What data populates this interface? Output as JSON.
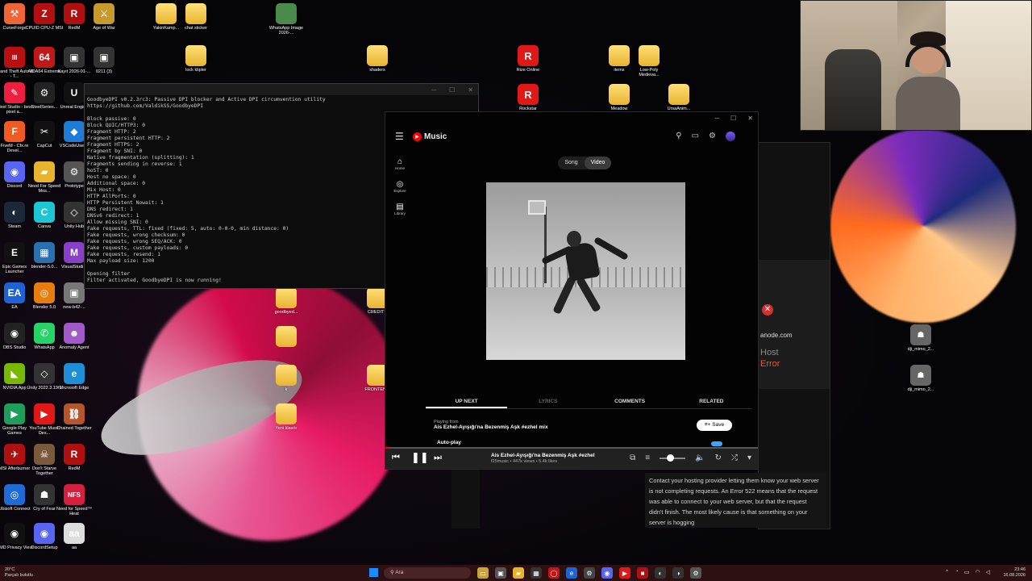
{
  "desktop": {
    "icons_left": [
      {
        "label": "CurseForge",
        "color": "#f16436",
        "glyph": "⚒"
      },
      {
        "label": "CPUID CPU-Z MSI",
        "color": "#b01010",
        "glyph": "Z"
      },
      {
        "label": "RedM",
        "color": "#b01010",
        "glyph": "R"
      },
      {
        "label": "Age of War",
        "color": "#c79a2e",
        "glyph": "⚔"
      },
      {
        "label": "Grand Theft Auto III - T...",
        "color": "#b81010",
        "glyph": "III"
      },
      {
        "label": "AIDA64 Extreme",
        "color": "#c01818",
        "glyph": "64"
      },
      {
        "label": "Kayıt 2026-01-...",
        "color": "#333",
        "glyph": "▣"
      },
      {
        "label": "0211 (3)",
        "color": "#333",
        "glyph": "▣"
      },
      {
        "label": "Pixel Studio - best pixel a...",
        "color": "#ee1e3e",
        "glyph": "✎"
      },
      {
        "label": "SteelSeries...",
        "color": "#222",
        "glyph": "⚙"
      },
      {
        "label": "Unreal Engine",
        "color": "#111",
        "glyph": "U"
      },
      {
        "label": "FiveM - Cfx.re Devel...",
        "color": "#f05a23",
        "glyph": "F"
      },
      {
        "label": "CapCut",
        "color": "#111",
        "glyph": "✂"
      },
      {
        "label": "VSCodeUser...",
        "color": "#1e7bd6",
        "glyph": "◆"
      },
      {
        "label": "Discord",
        "color": "#5865f2",
        "glyph": "◉"
      },
      {
        "label": "Need For Speed Mos...",
        "color": "#e8b42e",
        "glyph": "▰"
      },
      {
        "label": "Prototype",
        "color": "#555",
        "glyph": "⚙"
      },
      {
        "label": "Steam",
        "color": "#1b2838",
        "glyph": "◐"
      },
      {
        "label": "Canva",
        "color": "#1cc6d3",
        "glyph": "C"
      },
      {
        "label": "Unity Hub",
        "color": "#333",
        "glyph": "◇"
      },
      {
        "label": "Epic Games Launcher",
        "color": "#111",
        "glyph": "E"
      },
      {
        "label": "blender-5.0...",
        "color": "#2a6fb0",
        "glyph": "▦"
      },
      {
        "label": "VisualStudi...",
        "color": "#8a3fc9",
        "glyph": "M"
      },
      {
        "label": "EA",
        "color": "#1e63d6",
        "glyph": "EA"
      },
      {
        "label": "Blender 5.0",
        "color": "#e87d0d",
        "glyph": "◎"
      },
      {
        "label": "new-b42-...",
        "color": "#777",
        "glyph": "▣"
      },
      {
        "label": "OBS Studio",
        "color": "#222",
        "glyph": "◉"
      },
      {
        "label": "WhatsApp",
        "color": "#25d366",
        "glyph": "✆"
      },
      {
        "label": "Anomaly Agent",
        "color": "#a35ac9",
        "glyph": "☻"
      },
      {
        "label": "NVIDIA App",
        "color": "#76b900",
        "glyph": "◣"
      },
      {
        "label": "Unity 2022.3.19f1",
        "color": "#333",
        "glyph": "◇"
      },
      {
        "label": "Microsoft Edge",
        "color": "#1e8fd6",
        "glyph": "e"
      },
      {
        "label": "Google Play Games",
        "color": "#1e9e5a",
        "glyph": "▶"
      },
      {
        "label": "YouTube Music Des...",
        "color": "#e01818",
        "glyph": "▶"
      },
      {
        "label": "Chained Together",
        "color": "#b5552b",
        "glyph": "⛓"
      },
      {
        "label": "MSI Afterburner",
        "color": "#b01010",
        "glyph": "✈"
      },
      {
        "label": "Don't Starve Together",
        "color": "#7a5a3a",
        "glyph": "☠"
      },
      {
        "label": "RedM",
        "color": "#b01010",
        "glyph": "R"
      },
      {
        "label": "Ubisoft Connect",
        "color": "#1e6bd6",
        "glyph": "◎"
      },
      {
        "label": "Cry of Fear",
        "color": "#333",
        "glyph": "☗"
      },
      {
        "label": "Need for Speed™ Heat",
        "color": "#d61e3e",
        "glyph": "NFS"
      },
      {
        "label": "AMD Privacy View",
        "color": "#111",
        "glyph": "◉"
      },
      {
        "label": "DiscordSetup",
        "color": "#5865f2",
        "glyph": "◉"
      },
      {
        "label": "aa",
        "color": "#ddd",
        "glyph": "aa"
      }
    ],
    "icons_top": [
      {
        "label": "YakinKamp...",
        "type": "folder"
      },
      {
        "label": "chat sticker",
        "type": "folder"
      },
      {
        "label": "WhatsApp Image 2026-...",
        "type": "image"
      },
      {
        "label": "lock klipler",
        "type": "folder"
      },
      {
        "label": "shaders",
        "type": "folder"
      },
      {
        "label": "Rize Online",
        "type": "app"
      },
      {
        "label": "Rockstar",
        "type": "app"
      },
      {
        "label": "items",
        "type": "folder"
      },
      {
        "label": "Low-Poly Medieva...",
        "type": "folder"
      },
      {
        "label": "Meadow",
        "type": "folder"
      },
      {
        "label": "UrsaAnim...",
        "type": "folder"
      }
    ],
    "icons_middle": [
      {
        "label": "goodbyed...",
        "type": "folder"
      },
      {
        "label": "CREDITS",
        "type": "folder"
      },
      {
        "label": "",
        "type": "folder"
      },
      {
        "label": "k",
        "type": "folder"
      },
      {
        "label": "FRONTEN...",
        "type": "folder"
      },
      {
        "label": "Yeni klasör",
        "type": "folder"
      }
    ],
    "icons_right": [
      {
        "label": "dji_mimo_2..."
      },
      {
        "label": "dji_mimo_2..."
      }
    ]
  },
  "console": {
    "lines": [
      "GoodbyeDPI v0.2.3rc3: Passive DPI blocker and Active DPI circumvention utility",
      "https://github.com/ValdikSS/GoodbyeDPI",
      "",
      "Block passive: 0",
      "Block QUIC/HTTP3: 0",
      "Fragment HTTP: 2",
      "Fragment persistent HTTP: 2",
      "Fragment HTTPS: 2",
      "Fragment by SNI: 0",
      "Native fragmentation (splitting): 1",
      "Fragments sending in reverse: 1",
      "hoST: 0",
      "Host no space: 0",
      "Additional space: 0",
      "Mix Host: 0",
      "HTTP AllPorts: 0",
      "HTTP Persistent Nowait: 1",
      "DNS redirect: 1",
      "DNSv6 redirect: 1",
      "Allow missing SNI: 0",
      "Fake requests, TTL: fixed (fixed: 5, auto: 0-0-0, min distance: 0)",
      "Fake requests, wrong checksum: 0",
      "Fake requests, wrong SEQ/ACK: 0",
      "Fake requests, custom payloads: 0",
      "Fake requests, resend: 1",
      "Max payload size: 1200",
      "",
      "Opening filter",
      "Filter activated, GoodbyeDPI is now running!"
    ],
    "controls": [
      "─",
      "☐",
      "✕"
    ]
  },
  "ytmusic": {
    "app_name": "Music",
    "window_controls": [
      "─",
      "☐",
      "✕"
    ],
    "nav": [
      {
        "icon": "⌂",
        "label": "Home"
      },
      {
        "icon": "◎",
        "label": "Explore"
      },
      {
        "icon": "▤",
        "label": "Library"
      }
    ],
    "toggle": {
      "song": "Song",
      "video": "Video",
      "active": "video"
    },
    "tabs": [
      {
        "label": "UP NEXT",
        "state": "active"
      },
      {
        "label": "LYRICS",
        "state": "dim"
      },
      {
        "label": "COMMENTS",
        "state": "normal"
      },
      {
        "label": "RELATED",
        "state": "normal"
      }
    ],
    "playing_from_label": "Playing from",
    "playlist_title": "Ais Ezhel-Ayışığı'na Bezenmiş Aşk #ezhel mix",
    "save_label": "Save",
    "autoplay_label": "Auto-play"
  },
  "player": {
    "title": "Ais Ezhel-Ayışığı'na Bezenmiş Aşk #ezhel",
    "subtitle": "f25music • 447k views • 5.4k likes",
    "progress": 0.01,
    "volume": 0.4
  },
  "error_page": {
    "domain": "anode.com",
    "host": "Host",
    "error": "Error",
    "text": "Contact your hosting provider letting them know your web server is not completing requests. An Error 522 means that the request was able to connect to your web server, but that the request didn't finish. The most likely cause is that something on your server is hogging"
  },
  "taskbar": {
    "weather_temp": "20°C",
    "weather_desc": "Parçalı bulutlu",
    "search_label": "Ara",
    "time": "23:46",
    "date": "16.08.2026"
  }
}
